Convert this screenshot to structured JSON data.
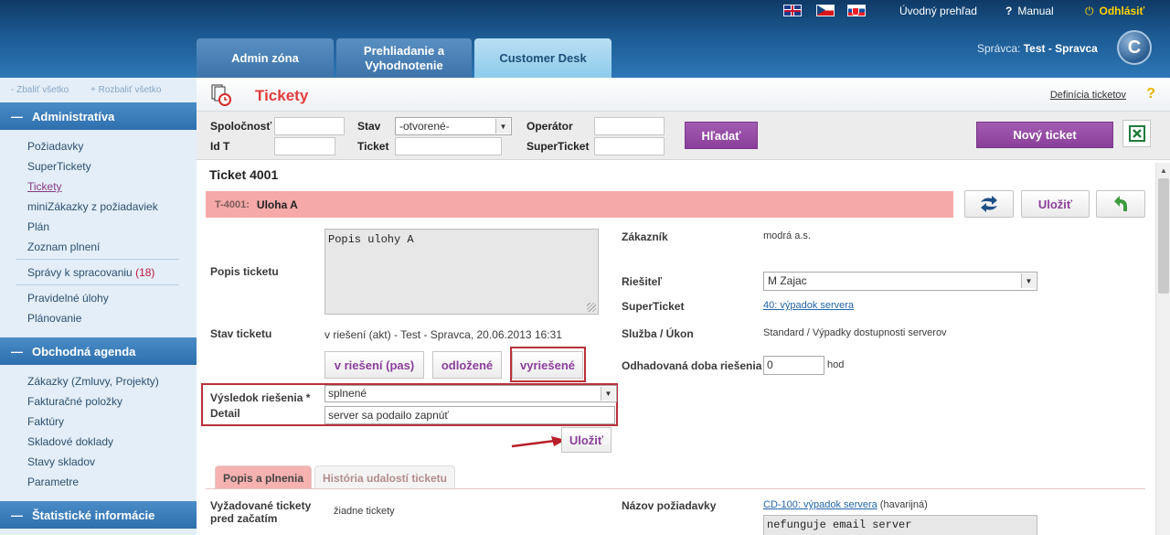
{
  "header": {
    "overview": "Úvodný prehľad",
    "manual": "Manual",
    "logout": "Odhlásiť",
    "tabs": [
      "Admin zóna",
      "Prehliadanie a Vyhodnotenie",
      "Customer Desk"
    ],
    "admin_prefix": "Správca:",
    "admin_name": "Test - Spravca",
    "logo": "C"
  },
  "sidebar": {
    "collapse_all": "- Zbaliť všetko",
    "expand_all": "+ Rozbaliť všetko",
    "sections": [
      "Administratíva",
      "Obchodná agenda",
      "Štatistické informácie"
    ],
    "admin_items": [
      "Požiadavky",
      "SuperTickety",
      "Tickety",
      "miniZákazky z požiadaviek",
      "Plán",
      "Zoznam plnení",
      "Správy k spracovaniu",
      "Pravidelné úlohy",
      "Plánovanie"
    ],
    "reports_count": "(18)",
    "trade_items": [
      "Zákazky (Zmluvy, Projekty)",
      "Fakturačné položky",
      "Faktúry",
      "Skladové doklady",
      "Stavy skladov",
      "Parametre"
    ]
  },
  "page": {
    "title": "Tickety",
    "definition_link": "Definícia ticketov",
    "help": "?"
  },
  "filters": {
    "company": "Spoločnosť",
    "state": "Stav",
    "state_value": "-otvorené-",
    "operator": "Operátor",
    "idt": "Id T",
    "ticket": "Ticket",
    "superticket": "SuperTicket",
    "search_button": "Hľadať",
    "new_button": "Nový ticket"
  },
  "ticket": {
    "header": "Ticket 4001",
    "id": "T-4001:",
    "name": "Uloha A",
    "save": "Uložiť",
    "desc_label": "Popis ticketu",
    "desc_value": "Popis ulohy A",
    "state_label": "Stav ticketu",
    "state_value": "v riešení (akt) - Test - Spravca, 20.06.2013 16:31",
    "state_buttons": [
      "v riešení (pas)",
      "odložené",
      "vyriešené"
    ],
    "result_label": "Výsledok riešenia *",
    "result_value": "splnené",
    "detail_label": "Detail",
    "detail_value": "server sa podailo zapnúť",
    "save_form": "Uložiť",
    "customer_label": "Zákazník",
    "customer_value": "modrá a.s.",
    "solver_label": "Riešiteľ",
    "solver_value": "M Zajac",
    "superticket_label": "SuperTicket",
    "superticket_value": "40: výpadok servera",
    "service_label": "Služba / Úkon",
    "service_value": "Standard / Výpadky dostupnosti serverov",
    "estimate_label": "Odhadovaná doba riešenia",
    "estimate_value": "0",
    "estimate_unit": "hod"
  },
  "subtabs": [
    "Popis a plnenia",
    "História udalostí ticketu"
  ],
  "bottom": {
    "required_label": "Vyžadované tickety pred začatím",
    "required_value": "žiadne tickety",
    "request_label": "Názov požiadavky",
    "request_link": "CD-100: výpadok servera",
    "request_priority": "(havarijná)",
    "request_desc": "nefunguje email server"
  }
}
